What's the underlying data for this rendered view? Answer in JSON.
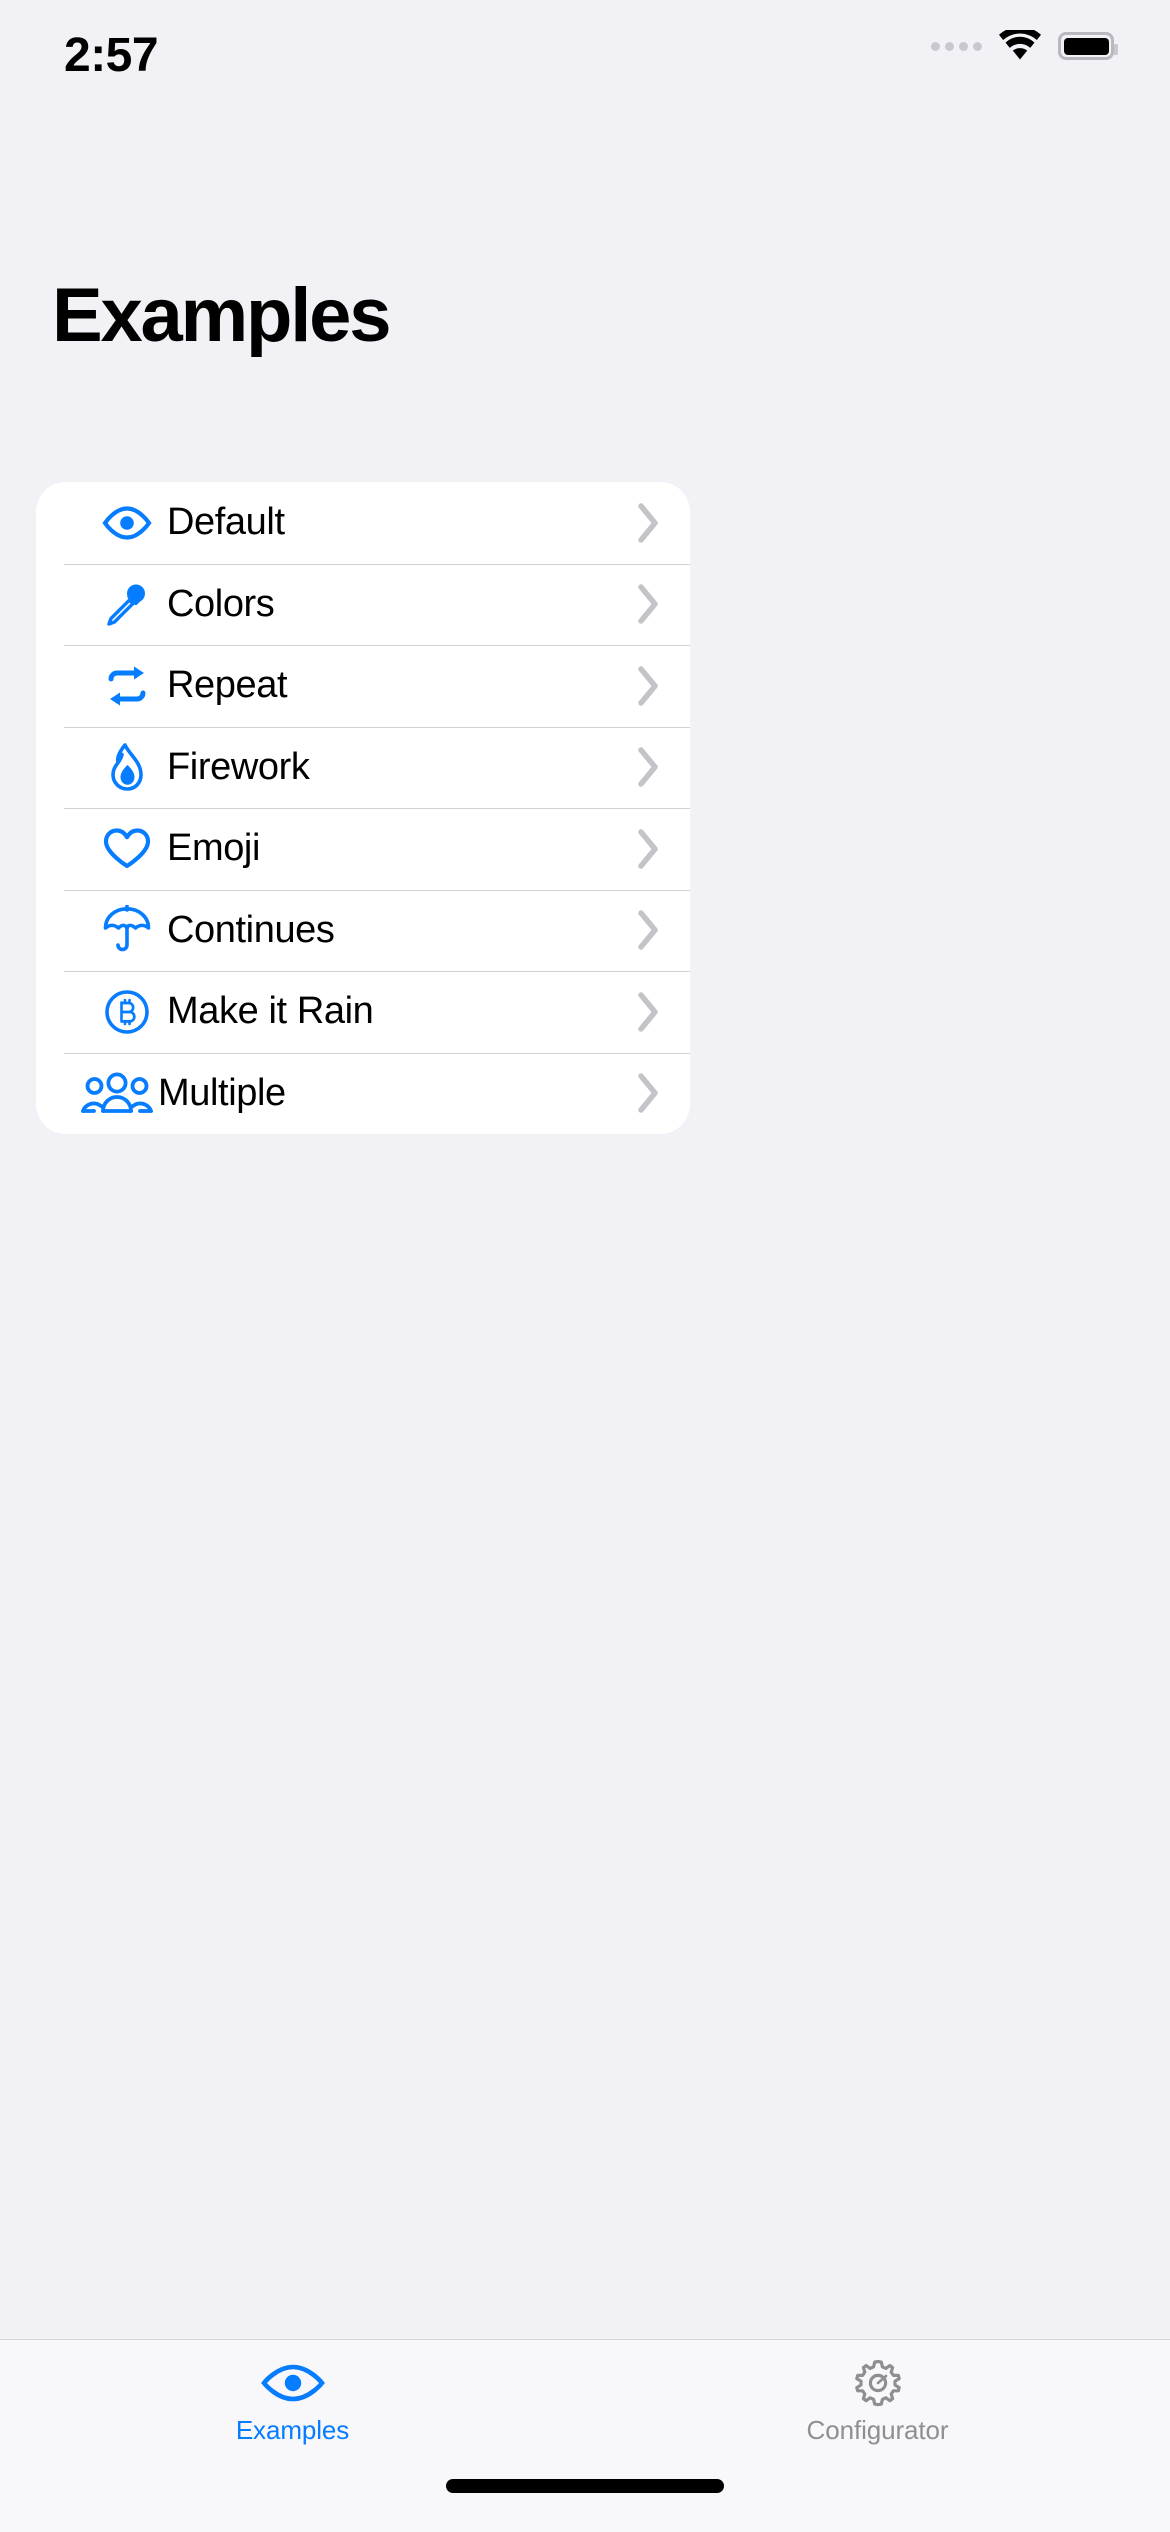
{
  "colors": {
    "accent": "#067cff",
    "background": "#f2f1f6",
    "card": "#ffffff",
    "divider": "#d2d1d6",
    "inactive_tab": "#8e8e93",
    "chevron": "#c4c4c8"
  },
  "status_bar": {
    "time": "2:57",
    "cellular_icon": "cellular-dots-icon",
    "wifi_icon": "wifi-icon",
    "battery_icon": "battery-full-icon"
  },
  "header": {
    "title": "Examples"
  },
  "list": {
    "items": [
      {
        "label": "Default",
        "icon": "eye-icon",
        "chevron": "chevron-right-icon"
      },
      {
        "label": "Colors",
        "icon": "eyedropper-icon",
        "chevron": "chevron-right-icon"
      },
      {
        "label": "Repeat",
        "icon": "repeat-icon",
        "chevron": "chevron-right-icon"
      },
      {
        "label": "Firework",
        "icon": "flame-icon",
        "chevron": "chevron-right-icon"
      },
      {
        "label": "Emoji",
        "icon": "heart-icon",
        "chevron": "chevron-right-icon"
      },
      {
        "label": "Continues",
        "icon": "umbrella-icon",
        "chevron": "chevron-right-icon"
      },
      {
        "label": "Make it Rain",
        "icon": "bitcoin-circle-icon",
        "chevron": "chevron-right-icon"
      },
      {
        "label": "Multiple",
        "icon": "person-3-group-icon",
        "chevron": "chevron-right-icon"
      }
    ]
  },
  "tab_bar": {
    "tabs": [
      {
        "label": "Examples",
        "icon": "eye-icon",
        "active": true
      },
      {
        "label": "Configurator",
        "icon": "gear-icon",
        "active": false
      }
    ]
  },
  "home_indicator": "home-indicator-bar"
}
